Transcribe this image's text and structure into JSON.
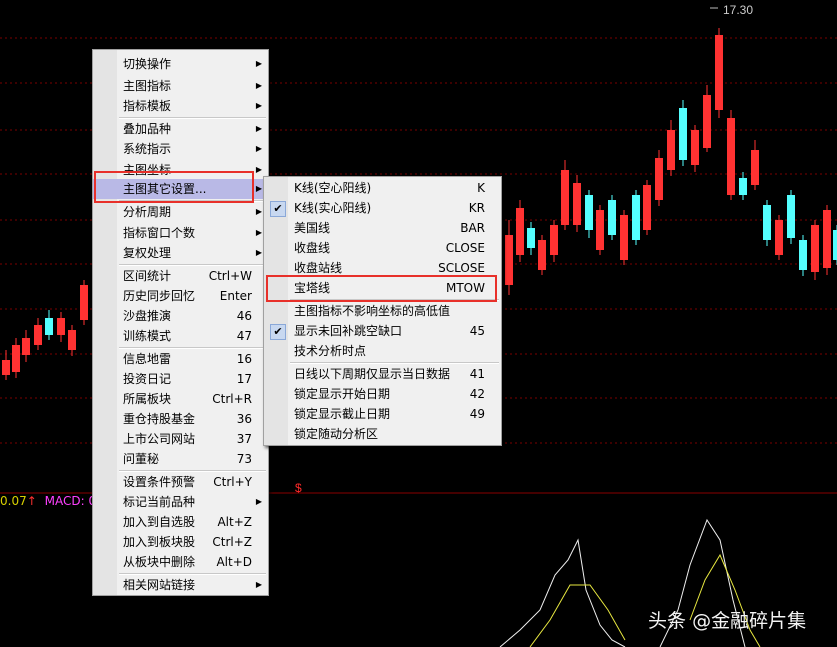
{
  "price_label": "17.30",
  "macd": {
    "left_value": "0.07",
    "left_arrow": "↑",
    "label": "MACD: 0"
  },
  "s_marker": "$",
  "watermark": {
    "brand": "头条",
    "account": "@金融碎片集"
  },
  "context_menu": {
    "items": [
      {
        "label": "切换操作",
        "submenu": true
      },
      {
        "label": "主图指标",
        "submenu": true
      },
      {
        "label": "指标模板",
        "submenu": true
      },
      {
        "label": "叠加品种",
        "submenu": true
      },
      {
        "label": "系统指示",
        "submenu": true
      },
      {
        "label": "主图坐标",
        "submenu": true
      },
      {
        "label": "主图其它设置...",
        "submenu": true
      },
      {
        "label": "分析周期",
        "submenu": true
      },
      {
        "label": "指标窗口个数",
        "submenu": true
      },
      {
        "label": "复权处理",
        "submenu": true
      },
      {
        "label": "区间统计",
        "shortcut": "Ctrl+W"
      },
      {
        "label": "历史同步回忆",
        "shortcut": "Enter"
      },
      {
        "label": "沙盘推演",
        "shortcut": "46"
      },
      {
        "label": "训练模式",
        "shortcut": "47"
      },
      {
        "label": "信息地雷",
        "shortcut": "16"
      },
      {
        "label": "投资日记",
        "shortcut": "17"
      },
      {
        "label": "所属板块",
        "shortcut": "Ctrl+R"
      },
      {
        "label": "重仓持股基金",
        "shortcut": "36"
      },
      {
        "label": "上市公司网站",
        "shortcut": "37"
      },
      {
        "label": "问董秘",
        "shortcut": "73"
      },
      {
        "label": "设置条件预警",
        "shortcut": "Ctrl+Y"
      },
      {
        "label": "标记当前品种",
        "submenu": true
      },
      {
        "label": "加入到自选股",
        "shortcut": "Alt+Z"
      },
      {
        "label": "加入到板块股",
        "shortcut": "Ctrl+Z"
      },
      {
        "label": "从板块中删除",
        "shortcut": "Alt+D"
      },
      {
        "label": "相关网站链接",
        "submenu": true
      }
    ]
  },
  "submenu": {
    "items": [
      {
        "label": "K线(空心阳线)",
        "shortcut": "K",
        "checked": false
      },
      {
        "label": "K线(实心阳线)",
        "shortcut": "KR",
        "checked": true
      },
      {
        "label": "美国线",
        "shortcut": "BAR",
        "checked": false
      },
      {
        "label": "收盘线",
        "shortcut": "CLOSE",
        "checked": false
      },
      {
        "label": "收盘站线",
        "shortcut": "SCLOSE",
        "checked": false
      },
      {
        "label": "宝塔线",
        "shortcut": "MTOW",
        "checked": false
      },
      {
        "label": "主图指标不影响坐标的高低值",
        "shortcut": "",
        "checked": false
      },
      {
        "label": "显示未回补跳空缺口",
        "shortcut": "45",
        "checked": true
      },
      {
        "label": "技术分析时点",
        "shortcut": "",
        "checked": false
      },
      {
        "label": "日线以下周期仅显示当日数据",
        "shortcut": "41",
        "checked": false
      },
      {
        "label": "锁定显示开始日期",
        "shortcut": "42",
        "checked": false
      },
      {
        "label": "锁定显示截止日期",
        "shortcut": "49",
        "checked": false
      },
      {
        "label": "锁定随动分析区",
        "shortcut": "",
        "checked": false
      }
    ]
  }
}
